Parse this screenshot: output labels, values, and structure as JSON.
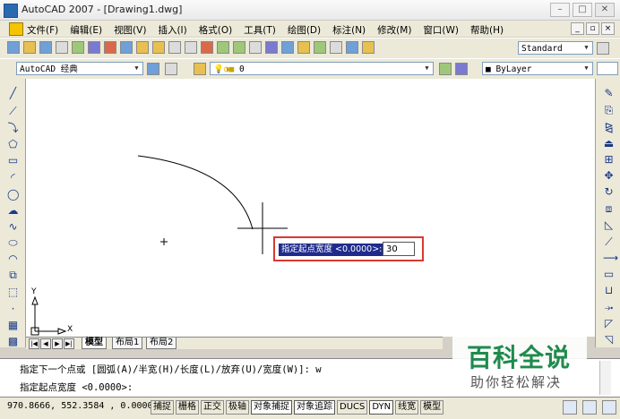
{
  "window": {
    "title": "AutoCAD 2007 - [Drawing1.dwg]",
    "minimize": "–",
    "maximize": "□",
    "close": "✕"
  },
  "menu": {
    "items": [
      "文件(F)",
      "编辑(E)",
      "视图(V)",
      "插入(I)",
      "格式(O)",
      "工具(T)",
      "绘图(D)",
      "标注(N)",
      "修改(M)",
      "窗口(W)",
      "帮助(H)"
    ]
  },
  "toolbar": {
    "text_style": "Standard",
    "workspace": "AutoCAD 经典",
    "layer": "0",
    "color": "ByLayer"
  },
  "layout_tabs": [
    "模型",
    "布局1",
    "布局2"
  ],
  "ucs": {
    "x": "X",
    "y": "Y"
  },
  "dynamic_input": {
    "prompt": "指定起点宽度 <0.0000>:",
    "value": "30"
  },
  "command_line": {
    "line1": "指定下一个点或 [圆弧(A)/半宽(H)/长度(L)/放弃(U)/宽度(W)]: w",
    "line2": "指定起点宽度 <0.0000>:"
  },
  "status": {
    "coordinates": "970.8666,  552.3584 , 0.0000",
    "buttons": [
      "捕捉",
      "栅格",
      "正交",
      "极轴",
      "对象捕捉",
      "对象追踪",
      "DUCS",
      "DYN",
      "线宽",
      "模型"
    ],
    "active": [
      "对象捕捉",
      "对象追踪",
      "DYN"
    ]
  },
  "watermark": {
    "title": "百科全说",
    "subtitle": "助你轻松解决"
  }
}
